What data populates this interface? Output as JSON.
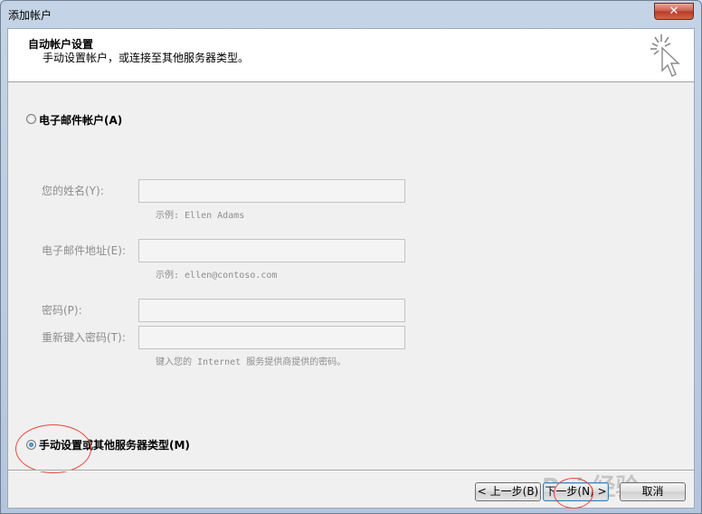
{
  "window": {
    "title": "添加帐户",
    "close_glyph": "✕"
  },
  "header": {
    "title": "自动帐户设置",
    "subtitle": "手动设置帐户，或连接至其他服务器类型。",
    "icon": "wizard-cursor-icon"
  },
  "options": {
    "email_account": {
      "label": "电子邮件帐户(A)",
      "selected": false
    },
    "manual_setup": {
      "label": "手动设置或其他服务器类型(M)",
      "selected": true
    }
  },
  "form": {
    "name_label": "您的姓名(Y):",
    "name_value": "",
    "name_hint": "示例: Ellen Adams",
    "email_label": "电子邮件地址(E):",
    "email_value": "",
    "email_hint": "示例: ellen@contoso.com",
    "password_label": "密码(P):",
    "password_value": "",
    "retype_label": "重新键入密码(T):",
    "retype_value": "",
    "password_hint": "键入您的 Internet 服务提供商提供的密码。"
  },
  "buttons": {
    "back": "< 上一步(B)",
    "next": "下一步(N) >",
    "cancel": "取消"
  },
  "watermark": "Bai 经验",
  "colors": {
    "annotation": "#e8473d",
    "titlebar": "#c4d4e6"
  }
}
